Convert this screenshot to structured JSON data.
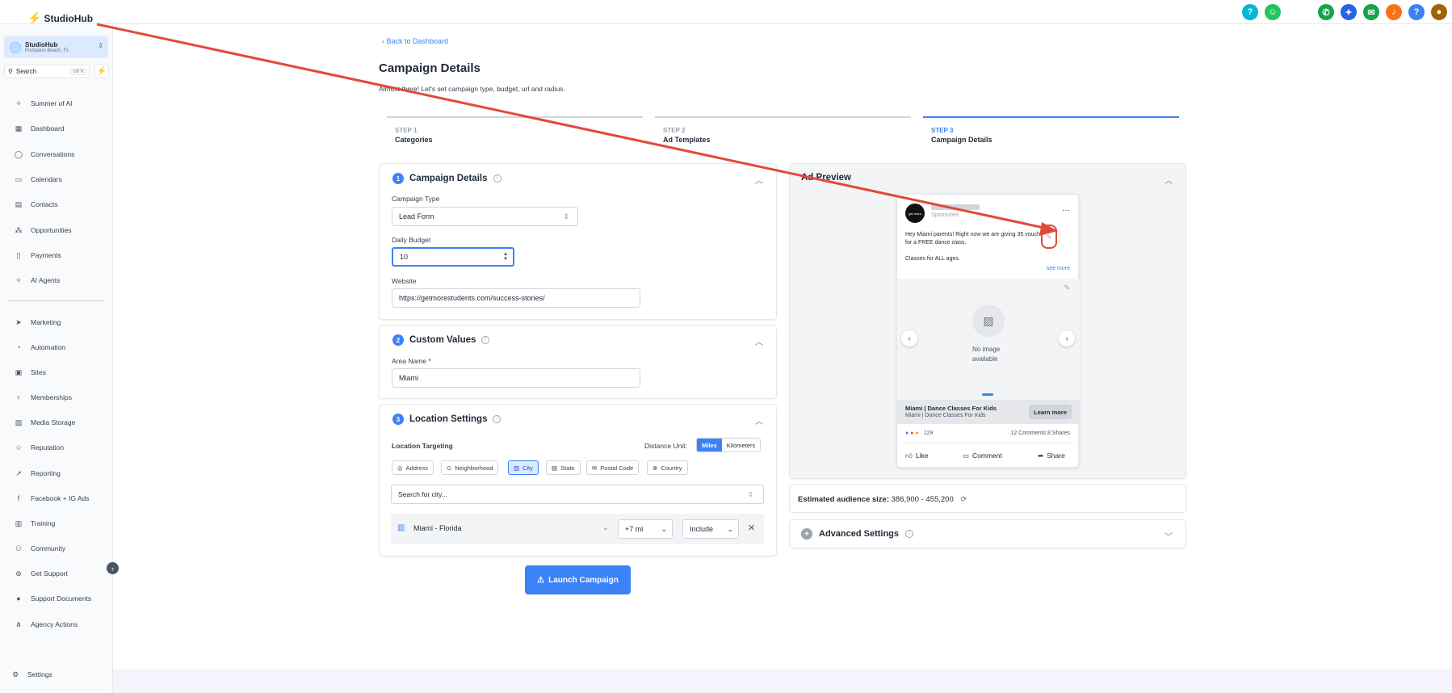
{
  "brand": {
    "name": "StudioHub"
  },
  "location": {
    "name": "StudioHub",
    "address": "Pompano Beach, FL"
  },
  "search": {
    "placeholder": "Search",
    "shortcut": "ctrl K"
  },
  "sidebar": {
    "items": [
      {
        "label": "Summer of AI",
        "icon": "sparkle-icon"
      },
      {
        "label": "Dashboard",
        "icon": "grid-icon"
      },
      {
        "label": "Conversations",
        "icon": "chat-icon"
      },
      {
        "label": "Calendars",
        "icon": "calendar-icon"
      },
      {
        "label": "Contacts",
        "icon": "contacts-icon"
      },
      {
        "label": "Opportunities",
        "icon": "pipeline-icon"
      },
      {
        "label": "Payments",
        "icon": "receipt-icon"
      },
      {
        "label": "AI Agents",
        "icon": "sparkle-icon"
      },
      {
        "label": "Marketing",
        "icon": "send-icon"
      },
      {
        "label": "Automation",
        "icon": "automation-icon"
      },
      {
        "label": "Sites",
        "icon": "sites-icon"
      },
      {
        "label": "Memberships",
        "icon": "membership-icon"
      },
      {
        "label": "Media Storage",
        "icon": "image-icon"
      },
      {
        "label": "Reputation",
        "icon": "star-icon"
      },
      {
        "label": "Reporting",
        "icon": "trend-icon"
      },
      {
        "label": "Facebook + IG Ads",
        "icon": "facebook-icon"
      },
      {
        "label": "Training",
        "icon": "book-icon"
      },
      {
        "label": "Community",
        "icon": "community-icon"
      },
      {
        "label": "Get Support",
        "icon": "support-icon"
      },
      {
        "label": "Support Documents",
        "icon": "info-icon"
      },
      {
        "label": "Agency Actions",
        "icon": "agency-icon"
      }
    ],
    "settings": "Settings"
  },
  "page": {
    "back": "Back to Dashboard",
    "title": "Campaign Details",
    "subtitle": "Almost there! Let's set campaign type, budget, url and radius."
  },
  "steps": [
    {
      "num": "STEP 1",
      "name": "Categories"
    },
    {
      "num": "STEP 2",
      "name": "Ad Templates"
    },
    {
      "num": "STEP 3",
      "name": "Campaign Details"
    }
  ],
  "campaign": {
    "badge": "1",
    "title": "Campaign Details",
    "type_label": "Campaign Type",
    "type_value": "Lead Form",
    "budget_label": "Daily Budget",
    "budget_value": "10",
    "website_label": "Website",
    "website_value": "https://getmorestudents.com/success-stories/"
  },
  "custom_values": {
    "badge": "2",
    "title": "Custom Values",
    "area_label": "Area Name *",
    "area_value": "Miami"
  },
  "location_settings": {
    "badge": "3",
    "title": "Location Settings",
    "targeting_label": "Location Targeting",
    "distance_label": "Distance Unit:",
    "unit_miles": "Miles",
    "unit_km": "Kilometers",
    "options": [
      "Address",
      "Neighborhood",
      "City",
      "State",
      "Postal Code",
      "Country"
    ],
    "active_option": "City",
    "city_placeholder": "Search for city...",
    "row_city": "Miami - Florida",
    "row_radius": "+7 mi",
    "row_mode": "Include"
  },
  "launch": "Launch Campaign",
  "ad_preview": {
    "title": "Ad Preview",
    "sponsored": "Sponsored",
    "avatar_text": "get more",
    "body_line1": "Hey Miami parents! Right now we are giving 35 vouchers",
    "body_line2": "for a FREE dance class.",
    "body_line3": "Classes for ALL ages.",
    "see_more": "see more",
    "no_image": "No image available",
    "headline": "Miami | Dance Classes For Kids",
    "subheadline": "Miami | Dance Classes For Kids",
    "cta": "Learn more",
    "reactions": "129",
    "engagement": "12 Comments 8 Shares",
    "like": "Like",
    "comment": "Comment",
    "share": "Share"
  },
  "audience": {
    "label": "Estimated audience size:",
    "value": "386,900 - 455,200"
  },
  "advanced": {
    "title": "Advanced Settings"
  },
  "colors": {
    "accent": "#3b82f6",
    "annotation": "#e04a3a"
  }
}
